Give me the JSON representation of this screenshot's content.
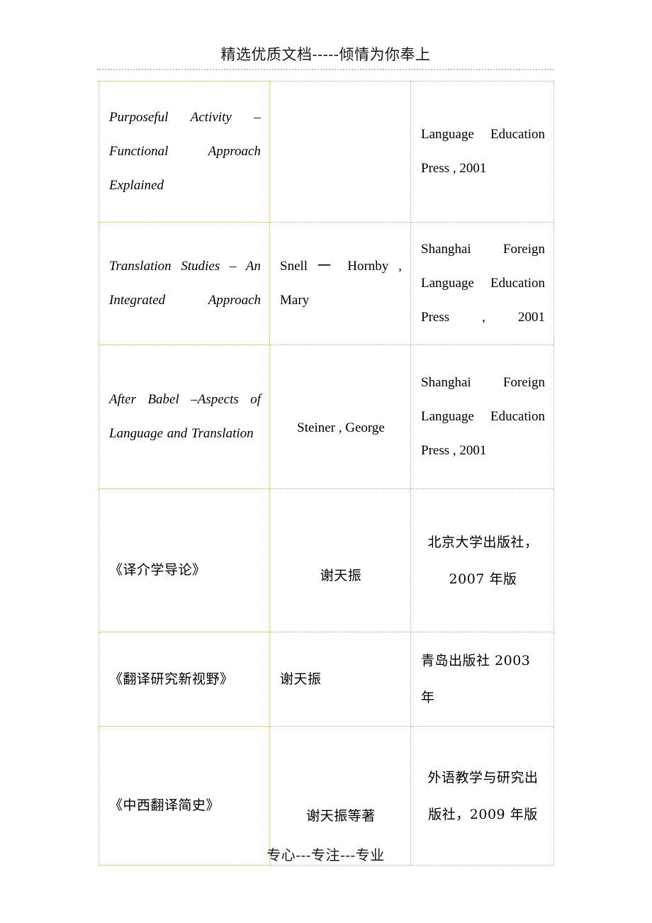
{
  "page": {
    "header_text": "精选优质文档-----倾情为你奉上",
    "footer_text": "专心---专注---专业"
  },
  "colors": {
    "table_border": "#d9a864",
    "header_rule": "#c3bccf",
    "text": "#000000",
    "page_background": "#ffffff"
  },
  "table": {
    "rows": [
      {
        "title": "Purposeful Activity –Functional Approach Explained",
        "author": "",
        "publisher": "Language Education Press , 2001"
      },
      {
        "title": "Translation Studies – An Integrated Approach",
        "author": "Snell 一 Hornby , Mary",
        "publisher": "Shanghai Foreign Language Education Press , 2001"
      },
      {
        "title": "After Babel –Aspects of Language and Translation",
        "author": "Steiner , George",
        "publisher": "Shanghai Foreign Language Education Press , 2001"
      },
      {
        "title": "《译介学导论》",
        "author": "谢天振",
        "publisher": "北京大学出版社，2007 年版"
      },
      {
        "title": "《翻译研究新视野》",
        "author": "谢天振",
        "publisher": "青岛出版社 2003 年"
      },
      {
        "title": "《中西翻译简史》",
        "author": "谢天振等著",
        "publisher": "外语教学与研究出版社，2009 年版"
      }
    ]
  }
}
